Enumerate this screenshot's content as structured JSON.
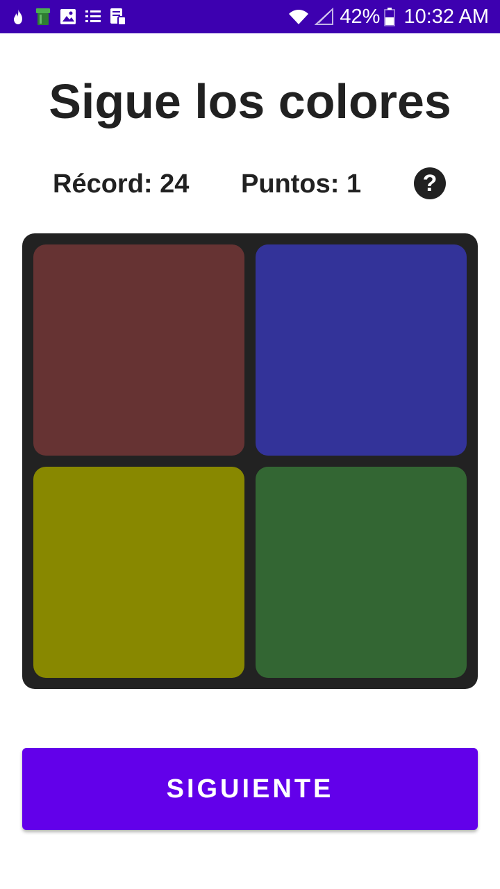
{
  "status_bar": {
    "background": "#3d00b0",
    "left_icons": [
      "flame-icon",
      "trash-icon",
      "image-icon",
      "list-icon",
      "sim-card-icon"
    ],
    "right_icons": [
      "wifi-icon",
      "cellular-signal-icon",
      "battery-icon"
    ],
    "battery": "42%",
    "time": "10:32 AM"
  },
  "title": "Sigue los colores",
  "stats": {
    "record": "Récord: 24",
    "points": "Puntos: 1"
  },
  "help": {
    "label": "?",
    "icon": "help-icon"
  },
  "board": {
    "background": "#222222",
    "tiles": [
      {
        "name": "red",
        "color": "#663333"
      },
      {
        "name": "blue",
        "color": "#333399"
      },
      {
        "name": "yellow",
        "color": "#888800"
      },
      {
        "name": "green",
        "color": "#336633"
      }
    ]
  },
  "next_button": {
    "label": "SIGUIENTE",
    "color": "#6200ea"
  }
}
